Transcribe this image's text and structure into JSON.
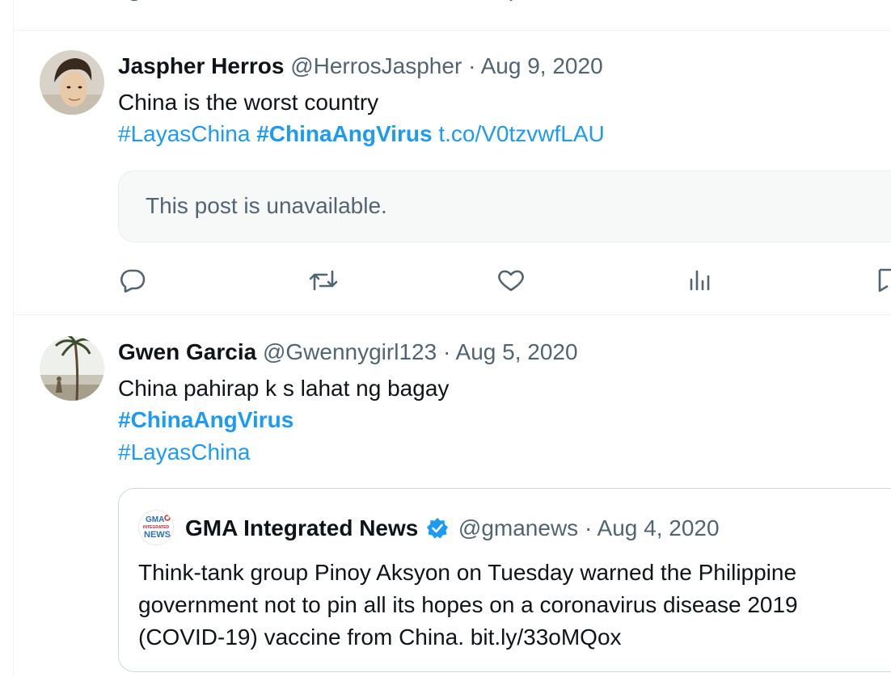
{
  "tweets": [
    {
      "name": "Jaspher Herros",
      "handle": "@HerrosJaspher",
      "separator": "·",
      "date": "Aug 9, 2020",
      "text": "China is the worst country",
      "hashtags_line": [
        "#LayasChina",
        "#ChinaAngVirus",
        "t.co/V0tzvwfLAU"
      ],
      "unavailable_text": "This post is unavailable."
    },
    {
      "name": "Gwen Garcia",
      "handle": "@Gwennygirl123",
      "separator": "·",
      "date": "Aug 5, 2020",
      "text": "China pahirap k s lahat ng bagay",
      "hashtag1": "#ChinaAngVirus",
      "hashtag2": "#LayasChina",
      "quote": {
        "logo_text_top": "GMA",
        "logo_text_mid": "INTEGRATED",
        "logo_text_bottom": "NEWS",
        "name": "GMA Integrated News",
        "handle": "@gmanews",
        "separator": "·",
        "date": "Aug 4, 2020",
        "text": "Think-tank group Pinoy Aksyon on Tuesday warned the Philippine government not to pin all its hopes on a coronavirus disease 2019 (COVID-19) vaccine from China. bit.ly/33oMQox"
      }
    }
  ],
  "icons": [
    "reply-icon",
    "repost-icon",
    "like-icon",
    "views-icon",
    "bookmark-icon",
    "verified-badge-icon"
  ],
  "colors": {
    "link": "#1d9bf0",
    "muted": "#536471",
    "text": "#0f1419",
    "border": "#eff3f4"
  }
}
